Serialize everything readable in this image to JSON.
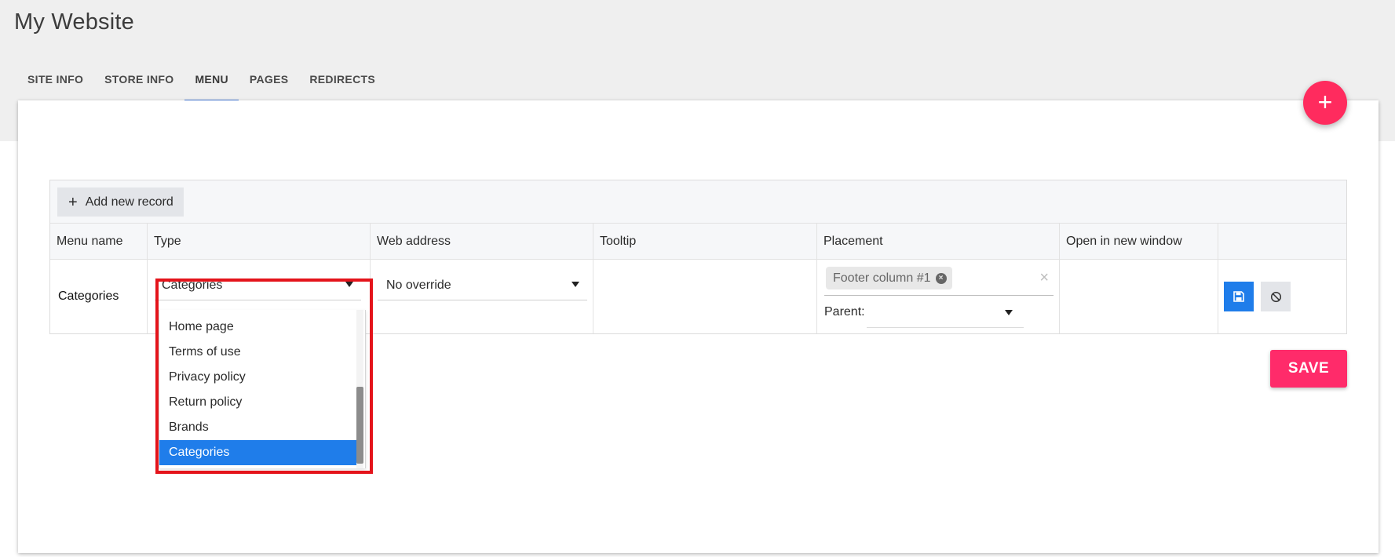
{
  "site": {
    "title": "My Website"
  },
  "tabs": [
    {
      "label": "SITE INFO",
      "active": false
    },
    {
      "label": "STORE INFO",
      "active": false
    },
    {
      "label": "MENU",
      "active": true
    },
    {
      "label": "PAGES",
      "active": false
    },
    {
      "label": "REDIRECTS",
      "active": false
    }
  ],
  "fab": {
    "icon": "plus-icon",
    "label": "+"
  },
  "grid": {
    "toolbar": {
      "add_label": "Add new record",
      "add_icon": "plus-icon",
      "add_symbol": "+"
    },
    "columns": [
      "Menu name",
      "Type",
      "Web address",
      "Tooltip",
      "Placement",
      "Open in new window",
      ""
    ],
    "row": {
      "menu_name": "Categories",
      "type_value": "Categories",
      "web_address_value": "No override",
      "tooltip": "",
      "placement_chip": "Footer column #1",
      "placement_clear": "×",
      "parent_label": "Parent:",
      "parent_value": "",
      "open_in_new_window": "",
      "save_icon": "floppy-disk-icon",
      "cancel_icon": "cancel-circle-icon"
    }
  },
  "type_dropdown": {
    "options": [
      "Home page",
      "Terms of use",
      "Privacy policy",
      "Return policy",
      "Brands",
      "Categories"
    ],
    "selected": "Categories"
  },
  "save": {
    "label": "SAVE"
  },
  "colors": {
    "accent_pink": "#ff2b6a",
    "tab_indicator": "#3f76d9",
    "primary_blue": "#1f7dea",
    "highlight_red": "#e4141b"
  }
}
